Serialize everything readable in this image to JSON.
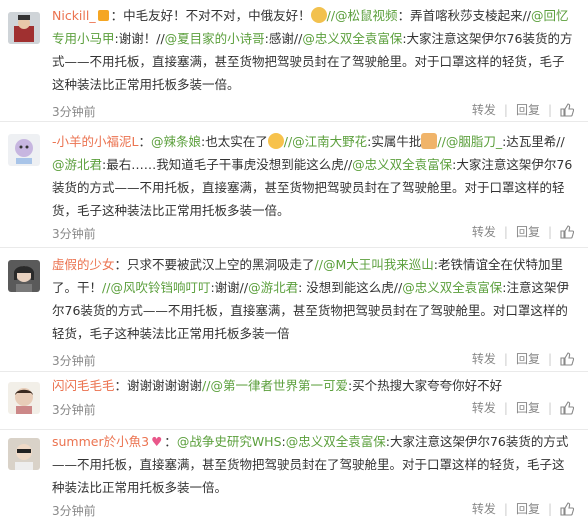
{
  "comments": [
    {
      "nick": "Nickill_",
      "pre": "：中毛友好！不对不对，中俄友好！",
      "mention1": "//@松鼠视频",
      "t1": "：弄首喀秋莎支棱起来//",
      "mention2": "@回忆专用小马甲",
      "t2": ":谢谢！//",
      "mention3": "@夏目家的小诗哥",
      "t3": ":感谢//",
      "mention4": "@忠义双全袁富保",
      "t4": ":大家注意这架伊尔76装货的方式——不用托板，直接塞满，甚至货物把驾驶员封在了驾驶舱里。对于口罩这样的轻货，毛子这种装法比正常用托板多装一倍。",
      "time": "3分钟前",
      "forward": "转发",
      "reply": "回复"
    },
    {
      "nick": "-小羊的小福泥L",
      "pre": "：",
      "mention1": "@辣条娘",
      "t1": ":也太实在了",
      "mention2": "//@江南大野花",
      "t2": ":实属牛批",
      "mention3": "//@胭脂刀_",
      "t3": ":达瓦里希//",
      "mention4": "@游北君",
      "t4": ":最右……我知道毛子干事虎没想到能这么虎//",
      "mention5": "@忠义双全袁富保",
      "t5": ":大家注意这架伊尔76装货的方式——不用托板，直接塞满，甚至货物把驾驶员封在了驾驶舱里。对于口罩这样的轻货，毛子这种装法比正常用托板多装一倍。",
      "time": "3分钟前",
      "forward": "转发",
      "reply": "回复"
    },
    {
      "nick": "虚假的少女",
      "pre": "：只求不要被武汉上空的黑洞吸走了",
      "mention1": "//@M大王叫我来巡山",
      "t1": ":老铁情谊全在伏特加里了。干！",
      "mention2": "//@风吹铃铛响叮叮",
      "t2": ":谢谢//",
      "mention3": "@游北君",
      "t3": ": 没想到能这么虎//",
      "mention4": "@忠义双全袁富保",
      "t4": ":注意这架伊尔76装货的方式——不用托板，直接塞满，甚至货物把驾驶员封在了驾驶舱里。对口罩这样的轻货，毛子这种装法比正常用托板多装一倍",
      "time": "3分钟前",
      "forward": "转发",
      "reply": "回复"
    },
    {
      "nick": "闪闪毛毛毛",
      "pre": "：谢谢谢谢谢谢",
      "mention1": "//@第一律者世界第一可爱",
      "t1": ":买个热搜大家夸夸你好不好",
      "time": "3分钟前",
      "forward": "转发",
      "reply": "回复"
    },
    {
      "nick": "summer於小魚3",
      "pre": "：",
      "mention1": "@战争史研究WHS",
      "t1": ":",
      "mention2": "@忠义双全袁富保",
      "t2": ":大家注意这架伊尔76装货的方式——不用托板，直接塞满，甚至货物把驾驶员封在了驾驶舱里。对于口罩这样的轻货，毛子这种装法比正常用托板多装一倍。",
      "time": "3分钟前",
      "forward": "转发",
      "reply": "回复"
    }
  ],
  "colors": {
    "nick": "#eb7350",
    "mention": "#5b9f3c",
    "meta": "#888888"
  }
}
